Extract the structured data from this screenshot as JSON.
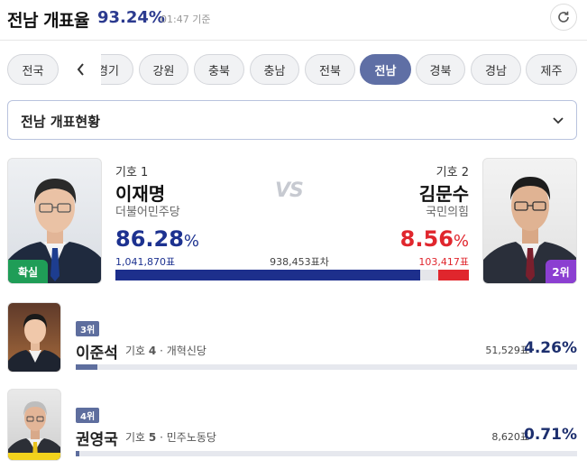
{
  "header": {
    "title": "전남 개표율",
    "rate": "93.24%",
    "time": "01:47 기준"
  },
  "tabs": [
    {
      "label": "전국",
      "active": false
    },
    {
      "label": "경기",
      "active": false
    },
    {
      "label": "강원",
      "active": false
    },
    {
      "label": "충북",
      "active": false
    },
    {
      "label": "충남",
      "active": false
    },
    {
      "label": "전북",
      "active": false
    },
    {
      "label": "전남",
      "active": true
    },
    {
      "label": "경북",
      "active": false
    },
    {
      "label": "경남",
      "active": false
    },
    {
      "label": "제주",
      "active": false
    }
  ],
  "dropdown": {
    "selected": "전남 개표현황"
  },
  "top": {
    "vs": "VS",
    "difference": "938,453표차",
    "c1": {
      "number": "기호 1",
      "name": "이재명",
      "party": "더불어민주당",
      "pct": "86.28",
      "pct_unit": "%",
      "votes": "1,041,870표",
      "badge": "확실",
      "share": 86.28
    },
    "c2": {
      "number": "기호 2",
      "name": "김문수",
      "party": "국민의힘",
      "pct": "8.56",
      "pct_unit": "%",
      "votes": "103,417표",
      "badge": "2위",
      "share": 8.56
    }
  },
  "others": [
    {
      "rank": "3위",
      "name": "이준석",
      "number_label": "기호",
      "number": "4",
      "party": "· 개혁신당",
      "votes": "51,529표",
      "pct": "4.26%",
      "share": 4.26
    },
    {
      "rank": "4위",
      "name": "권영국",
      "number_label": "기호",
      "number": "5",
      "party": "· 민주노동당",
      "votes": "8,620표",
      "pct": "0.71%",
      "share": 0.71
    }
  ],
  "colors": {
    "blue": "#1d2f8c",
    "red": "#e0262d",
    "accent": "#5f6fa5",
    "win": "#1f9d57",
    "rank": "#8b3fd1"
  }
}
